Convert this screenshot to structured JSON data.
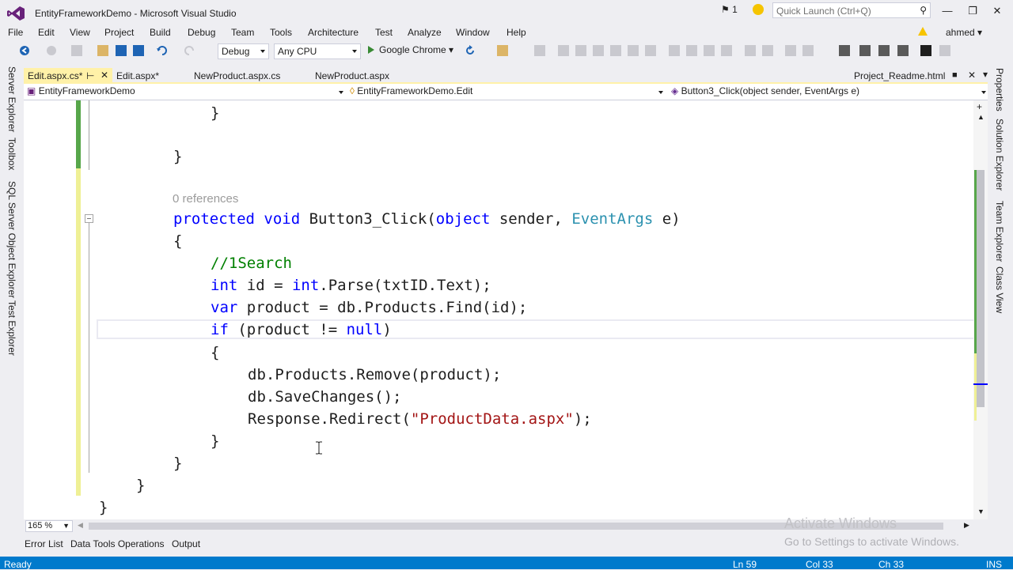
{
  "window": {
    "title": "EntityFrameworkDemo - Microsoft Visual Studio",
    "notification_count": "1",
    "quick_launch_placeholder": "Quick Launch (Ctrl+Q)",
    "user": "ahmed"
  },
  "menu": [
    "File",
    "Edit",
    "View",
    "Project",
    "Build",
    "Debug",
    "Team",
    "Tools",
    "Architecture",
    "Test",
    "Analyze",
    "Window",
    "Help"
  ],
  "toolbar": {
    "configuration": "Debug",
    "platform": "Any CPU",
    "run_target": "Google Chrome"
  },
  "left_tabs": [
    "Server Explorer",
    "Toolbox",
    "SQL Server Object Explorer",
    "Test Explorer"
  ],
  "right_tabs": [
    "Properties",
    "Solution Explorer",
    "Team Explorer",
    "Class View"
  ],
  "doc_tabs": {
    "active": "Edit.aspx.cs*",
    "others": [
      "Edit.aspx*",
      "NewProduct.aspx.cs",
      "NewProduct.aspx"
    ],
    "preview": "Project_Readme.html"
  },
  "navbar": {
    "project": "EntityFrameworkDemo",
    "type": "EntityFrameworkDemo.Edit",
    "member": "Button3_Click(object sender, EventArgs e)"
  },
  "code": {
    "references": "0 references"
  },
  "zoom": "165 %",
  "bottom_tabs": [
    "Error List",
    "Data Tools Operations",
    "Output"
  ],
  "watermark": {
    "line1": "Activate Windows",
    "line2": "Go to Settings to activate Windows."
  },
  "status": {
    "state": "Ready",
    "line": "Ln 59",
    "col": "Col 33",
    "ch": "Ch 33",
    "mode": "INS"
  },
  "colors": {
    "accent": "#007acc",
    "keyword": "#0000ff",
    "type": "#2b91af",
    "comment": "#008000",
    "string": "#a31515",
    "active_tab": "#fff1a8"
  }
}
